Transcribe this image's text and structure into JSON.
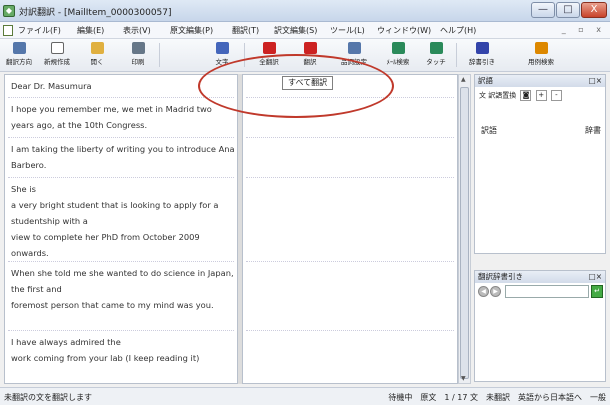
{
  "window": {
    "title": "対訳翻訳 - [MailItem_0000300057]",
    "minimize": "—",
    "maximize": "□",
    "close": "X"
  },
  "menu": [
    "ファイル(F)",
    "編集(E)",
    "表示(V)",
    "原文編集(P)",
    "翻訳(T)",
    "訳文編集(S)",
    "ツール(L)",
    "ウィンドウ(W)",
    "ヘルプ(H)"
  ],
  "mdi_controls": "_ ▫ x",
  "toolbar": [
    {
      "label": "翻訳方向",
      "icon": "direction-icon",
      "color": "#5577aa"
    },
    {
      "label": "新規作成",
      "icon": "new-doc-icon",
      "color": "#ffffff"
    },
    {
      "label": "開く",
      "icon": "open-folder-icon",
      "color": "#e0b040"
    },
    {
      "label": "印刷",
      "icon": "printer-icon",
      "color": "#667788"
    },
    {
      "label": "文字",
      "icon": "text-icon",
      "color": "#4466bb"
    },
    {
      "label": "全翻訳",
      "icon": "translate-all-icon",
      "color": "#cc2222"
    },
    {
      "label": "翻訳",
      "icon": "translate-icon",
      "color": "#cc2222"
    },
    {
      "label": "品詞設定",
      "icon": "pos-settings-icon",
      "color": "#5577aa"
    },
    {
      "label": "ﾒｰﾙ検索",
      "icon": "search-icon",
      "color": "#2a8a5a"
    },
    {
      "label": "タッチ",
      "icon": "touch-icon",
      "color": "#2a8a5a"
    },
    {
      "label": "辞書引き",
      "icon": "dictionary-icon",
      "color": "#3344aa"
    },
    {
      "label": "用例検索",
      "icon": "example-search-icon",
      "color": "#dd8800"
    }
  ],
  "tooltip": "すべて翻訳",
  "source_segments": [
    "Dear Dr. Masumura",
    "I hope you remember me, we met in Madrid two years ago, at the 10th Congress.",
    "I am taking the liberty of writing you to introduce Ana Barbero.",
    "She is\na very bright student that is looking to apply for a studentship with a\nview to complete her PhD from October 2009 onwards.",
    "When she told me she wanted to do science in Japan, the first and\nforemost person that came to my mind was you.",
    "I have always admired the\nwork coming from your lab (I keep reading it)"
  ],
  "dict_panel": {
    "title": "訳語",
    "tool_label": "訳語置換",
    "col_term": "訳語",
    "col_dict": "辞書"
  },
  "lookup_panel": {
    "title": "翻訳辞書引き",
    "input_value": ""
  },
  "status": {
    "left": "未翻訳の文を翻訳します",
    "right": "待機中　原文　1 / 17 文　未翻訳　英語から日本語へ　一般"
  }
}
